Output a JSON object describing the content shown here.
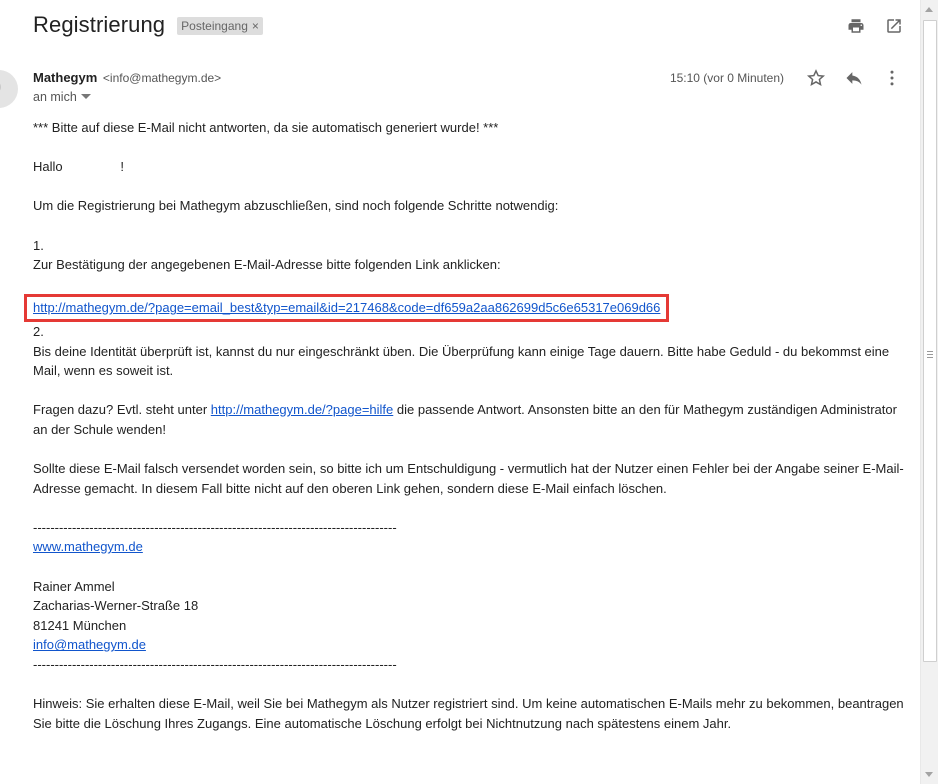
{
  "header": {
    "subject": "Registrierung",
    "label": "Posteingang",
    "label_remove": "×"
  },
  "message": {
    "sender_name": "Mathegym",
    "sender_email": "<info@mathegym.de>",
    "recipient": "an mich",
    "time": "15:10 (vor 0 Minuten)"
  },
  "body": {
    "line1": "*** Bitte auf diese E-Mail nicht antworten, da sie automatisch generiert wurde! ***",
    "greeting": "Hallo                !",
    "intro": "Um die Registrierung bei Mathegym abzuschließen, sind noch folgende Schritte notwendig:",
    "step1_num": "1.",
    "step1_text": "Zur Bestätigung der angegebenen E-Mail-Adresse bitte folgenden Link anklicken:",
    "confirm_link": "http://mathegym.de/?page=email_best&typ=email&id=217468&code=df659a2aa862699d5c6e65317e069d66",
    "step2_num": "2.",
    "step2_text": "Bis deine Identität überprüft ist, kannst du nur eingeschränkt üben. Die Überprüfung kann einige Tage dauern. Bitte habe Geduld - du bekommst eine Mail, wenn es soweit ist.",
    "questions_before": "Fragen dazu? Evtl. steht unter ",
    "help_link": "http://mathegym.de/?page=hilfe",
    "questions_after": " die passende Antwort. Ansonsten bitte an den für Mathegym zuständigen Administrator an der Schule wenden!",
    "wrong_mail": "Sollte diese E-Mail falsch versendet worden sein, so bitte ich um Entschuldigung - vermutlich hat der Nutzer einen Fehler bei der Angabe seiner E-Mail-Adresse gemacht. In diesem Fall bitte nicht auf den oberen Link gehen, sondern diese E-Mail einfach löschen.",
    "separator": "------------------------------------------------------------------------------------",
    "website_link": "www.mathegym.de",
    "name": "Rainer Ammel",
    "street": "Zacharias-Werner-Straße 18",
    "city": "81241 München",
    "contact_email": "info@mathegym.de",
    "notice": "Hinweis: Sie erhalten diese E-Mail, weil Sie bei Mathegym als Nutzer registriert sind. Um keine automatischen E-Mails mehr zu bekommen, beantragen Sie bitte die Löschung Ihres Zugangs. Eine automatische Löschung erfolgt bei Nichtnutzung nach spätestens einem Jahr."
  },
  "colors": {
    "link": "#1155cc",
    "highlight_box": "#e53935"
  }
}
